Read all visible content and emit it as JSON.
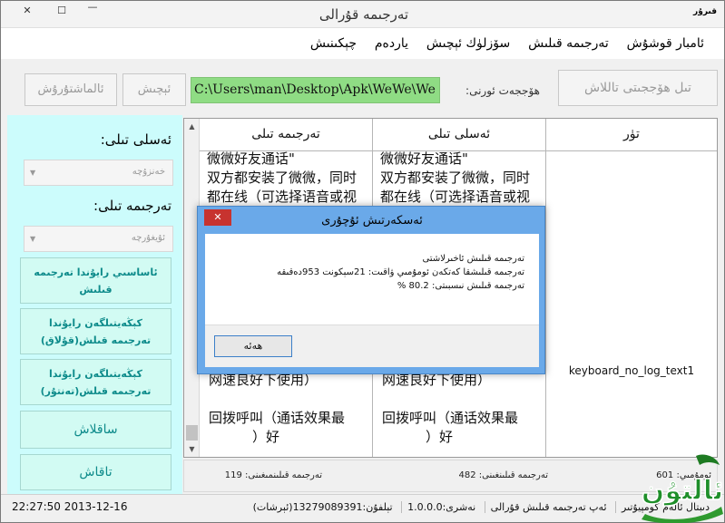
{
  "window": {
    "title": "تەرجىمە قۇرالى",
    "icon_label": "قىرۇر",
    "close_symbol": "✕",
    "maximize_symbol": "☐",
    "minimize_symbol": "—"
  },
  "menu": {
    "items": [
      "ئامبار قوشۇش",
      "تەرجىمە قىلىش",
      "سۆزلۈك ئېچىش",
      "ياردەم",
      "چېكىنىش"
    ]
  },
  "toolbar": {
    "select_file_label": "تىل ھۆججىتى تاللاش",
    "file_path_label": "ھۆججەت ئورنى:",
    "file_path_value": "C:\\Users\\man\\Desktop\\Apk\\WeWe\\We",
    "open_label": "ئېچىش",
    "check_label": "ئالماشتۇرۇش"
  },
  "sidebar": {
    "source_language_label": "ئەسلى تىلى:",
    "source_language_value": "خەنزۇچە",
    "target_language_label": "تەرجىمە تىلى:",
    "target_language_value": "ئۇيغۇرچە",
    "dropdown_arrow": "▼",
    "buttons": [
      "ئاساسىي رايۇندا تەرجىمە قىلىش",
      "كېڭەيتىلگەن رايۇندا تەرجىمە قىلش(قۇلاق)",
      "كېڭەيتىلگەن رايۇندا تەرجىمە قىلش(تەنتۇر)",
      "ساقلاش",
      "تاقاش"
    ]
  },
  "grid": {
    "headers": {
      "translation": "تەرجىمە تىلى",
      "original": "ئەسلى تىلى",
      "type": "تۈر"
    },
    "translation_cell": {
      "top_lines": [
        "微微好友通话\"",
        "双方都安装了微微，同时",
        "都在线（可选择语音或视"
      ],
      "bottom_lines": [
        "网速良好下使用）",
        "",
        "回拨呼叫（通话效果最",
        "）好"
      ]
    },
    "original_cell": {
      "top_lines": [
        "微微好友通话\"",
        "双方都安装了微微，同时",
        "都在线（可选择语音或视"
      ],
      "bottom_lines": [
        "网速良好下使用）",
        "",
        "回拨呼叫（通话效果最",
        "）好"
      ]
    },
    "type_cell": {
      "keyword": "keyboard_no_log_text1"
    },
    "scroll_up": "▲",
    "scroll_down": "▼"
  },
  "stats": {
    "total": "ئومۇمىي: 601",
    "done": "تەرجىمە قىلىنغىنى: 482",
    "remaining": "تەرجىمە قىلىنمىغىنى: 119"
  },
  "statusbar": {
    "datetime": "22:27:50 2013-12-16",
    "items": [
      "دىبتال ئالەم كومپيۇتىر",
      "ئەپ تەرجىمە قىلىش قۇرالى",
      "نەشرى:1.0.0.0",
      "تېلفۇن:13279089391(ئېرشات)"
    ]
  },
  "logo": {
    "text": "ئالتۇن"
  },
  "dialog": {
    "title": "ئەسكەرتىش ئۇچۇرى",
    "close_symbol": "✕",
    "lines": [
      "تەرجىمە قىلىش ئاخىرلاشتى",
      "تەرجىمە قىلىشقا كەتكەن ئومۇمىي ۋاقىت: 21سېكونت 953دەقىقە",
      "تەرجىمە قىلىش نىسبىتى: 80.2 %"
    ],
    "ok_label": "ھەئە"
  }
}
